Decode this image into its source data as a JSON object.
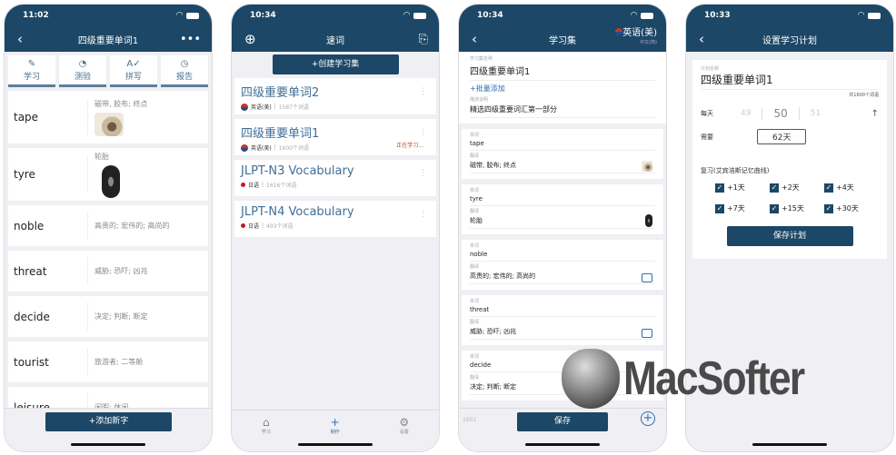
{
  "screen1": {
    "time": "11:02",
    "title": "四级重要单词1",
    "back_icon": "‹",
    "more_icon": "•••",
    "tools": [
      {
        "icon": "✎",
        "label": "学习"
      },
      {
        "icon": "◔",
        "label": "测验"
      },
      {
        "icon": "A✓",
        "label": "拼写"
      },
      {
        "icon": "◷",
        "label": "报告"
      }
    ],
    "words": [
      {
        "word": "tape",
        "def": "磁带, 胶布; 终点"
      },
      {
        "word": "tyre",
        "def": "轮胎"
      },
      {
        "word": "noble",
        "def": "高贵的; 宏伟的; 高尚的"
      },
      {
        "word": "threat",
        "def": "威胁; 恐吓; 凶兆"
      },
      {
        "word": "decide",
        "def": "决定; 判断; 断定"
      },
      {
        "word": "tourist",
        "def": "旅游者; 二等舱"
      },
      {
        "word": "leisure",
        "def": "闲暇; 休闲"
      }
    ],
    "add_button": "+添加新字"
  },
  "screen2": {
    "time": "10:34",
    "title": "速词",
    "create_button": "+创建学习集",
    "sets": [
      {
        "title": "四级重要单词2",
        "lang": "英语(美)",
        "count": "1587个词语",
        "status": ""
      },
      {
        "title": "四级重要单词1",
        "lang": "英语(美)",
        "count": "1600个词语",
        "status": "正在学习..."
      },
      {
        "title": "JLPT-N3 Vocabulary",
        "lang": "日语",
        "count": "1616个词语",
        "status": ""
      },
      {
        "title": "JLPT-N4 Vocabulary",
        "lang": "日语",
        "count": "493个词语",
        "status": ""
      }
    ],
    "tabs": [
      {
        "icon": "⌂",
        "label": "学习"
      },
      {
        "icon": "+",
        "label": "制作"
      },
      {
        "icon": "⚙",
        "label": "设置"
      }
    ]
  },
  "screen3": {
    "time": "10:34",
    "title": "学习集",
    "lang_main": "英语(美)",
    "lang_sub": "中文(简)",
    "set_name_label": "学习集名称",
    "set_name": "四级重要单词1",
    "batch_add": "+批量添加",
    "desc_label": "描述说明",
    "desc": "精选四级重要词汇第一部分",
    "word_label": "单词",
    "def_label": "翻译",
    "cards": [
      {
        "word": "tape",
        "def": "磁带, 胶布; 终点"
      },
      {
        "word": "tyre",
        "def": "轮胎"
      },
      {
        "word": "noble",
        "def": "高贵的; 宏伟的; 高尚的"
      },
      {
        "word": "threat",
        "def": "威胁; 恐吓; 凶兆"
      },
      {
        "word": "decide",
        "def": "决定; 判断; 断定"
      }
    ],
    "count": "1601",
    "save_button": "保存",
    "plus_icon": "+"
  },
  "screen4": {
    "time": "10:33",
    "title": "设置学习计划",
    "plan_name_label": "计划名称",
    "plan_name": "四级重要单词1",
    "total": "共1600个词语",
    "per_day_label": "每天",
    "per_day_prev": "49",
    "per_day_value": "50",
    "per_day_next": "51",
    "need_label": "需要",
    "need_value": "62天",
    "review_label": "复习(艾宾浩斯记忆曲线)",
    "review_options": [
      {
        "label": "+1天",
        "checked": true
      },
      {
        "label": "+2天",
        "checked": true
      },
      {
        "label": "+4天",
        "checked": true
      },
      {
        "label": "+7天",
        "checked": true
      },
      {
        "label": "+15天",
        "checked": true
      },
      {
        "label": "+30天",
        "checked": true
      }
    ],
    "save_plan_button": "保存计划"
  },
  "watermark": "MacSofter",
  "colors": {
    "primary": "#1c4766",
    "link": "#2c6fb0",
    "accent_red": "#c0392b"
  }
}
